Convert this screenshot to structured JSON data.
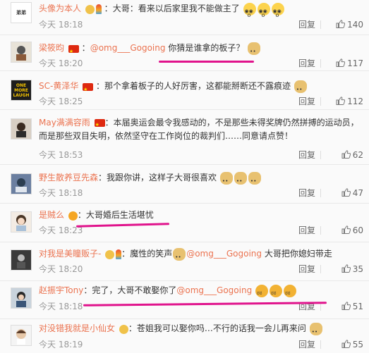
{
  "labels": {
    "reply": "回复"
  },
  "comments": [
    {
      "name": "头像为本人",
      "sep": "：",
      "text": "大哥：看来以后家里我不能做主了",
      "time": "今天 18:18",
      "likes": "140",
      "avatar_text": "弟弟"
    },
    {
      "name": "梁筱昀",
      "sep": "：",
      "mention": "@omg___Gogoing",
      "text": " 你猜是谁拿的板子？",
      "time": "今天 18:20",
      "likes": "117"
    },
    {
      "name": "SC-黄泽华",
      "sep": "：",
      "text": "那个拿着板子的人好厉害，这都能掰断还不露痕迹",
      "time": "今天 18:25",
      "likes": "112",
      "avatar_text": "ONE MORE LAUGH"
    },
    {
      "name": "May满满容雨",
      "sep": "：",
      "text": "本届奥运会最令我感动的，不是那些未得奖牌仍然拼搏的运动员，而是那些双目失明，依然坚守在工作岗位的裁判们……同意请点赞！",
      "time": "今天 18:53",
      "likes": "62"
    },
    {
      "name": "野生散养豆先森",
      "sep": "：",
      "text": "我跟你讲，这样子大哥很喜欢",
      "time": "今天 18:18",
      "likes": "47"
    },
    {
      "name": "是贼么",
      "sep": "：",
      "text": "大哥婚后生活堪忧",
      "time": "今天 18:23",
      "likes": "60"
    },
    {
      "name": "对我是美瞳贩子-",
      "sep": "：",
      "text": "魔性的笑声",
      "mention": "@omg___Gogoing",
      "text2": " 大哥把你媳妇带走",
      "time": "今天 18:20",
      "likes": "35"
    },
    {
      "name": "赵振宇Tony",
      "sep": "：",
      "text": "完了，大哥不敢娶你了",
      "mention": "@omg___Gogoing",
      "time": "今天 18:18",
      "likes": "51"
    },
    {
      "name": "对没错我就是小仙女",
      "sep": "：",
      "text": "苍姐我可以娶你吗…不行的话我一会儿再来问",
      "time": "今天 18:19",
      "likes": "55"
    }
  ],
  "colors": {
    "name": "#eb7350",
    "underline": "#e0138c"
  }
}
